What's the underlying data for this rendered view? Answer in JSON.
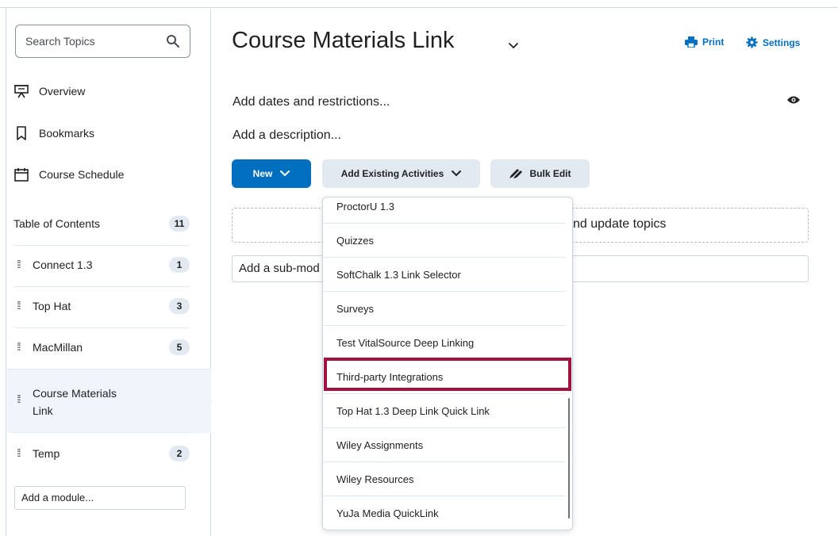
{
  "sidebar": {
    "search_placeholder": "Search Topics",
    "nav": [
      {
        "label": "Overview",
        "icon": "presentation-board-icon"
      },
      {
        "label": "Bookmarks",
        "icon": "bookmark-icon"
      },
      {
        "label": "Course Schedule",
        "icon": "calendar-icon"
      }
    ],
    "toc_label": "Table of Contents",
    "toc_count": "11",
    "modules": [
      {
        "label": "Connect 1.3",
        "count": "1"
      },
      {
        "label": "Top Hat",
        "count": "3"
      },
      {
        "label": "MacMillan",
        "count": "5"
      },
      {
        "label_line1": "Course Materials",
        "label_line2": "Link",
        "active": true
      },
      {
        "label": "Temp",
        "count": "2"
      }
    ],
    "add_module": "Add a module..."
  },
  "main": {
    "title": "Course Materials Link",
    "print_label": "Print",
    "settings_label": "Settings",
    "add_dates": "Add dates and restrictions...",
    "add_description": "Add a description...",
    "new_button": "New",
    "add_existing_button": "Add Existing Activities",
    "bulk_edit_button": "Bulk Edit",
    "dropzone_text_visible": "nd update topics",
    "submodule_text_visible": "Add a sub-mod"
  },
  "dropdown": {
    "items": [
      "ProctorU 1.3",
      "Quizzes",
      "SoftChalk 1.3 Link Selector",
      "Surveys",
      "Test VitalSource Deep Linking",
      "Third-party Integrations",
      "Top Hat 1.3 Deep Link Quick Link",
      "Wiley Assignments",
      "Wiley Resources",
      "YuJa Media QuickLink"
    ],
    "highlighted": "Third-party Integrations"
  },
  "colors": {
    "primary": "#006fbf",
    "highlight": "#a3123f",
    "badge": "#e3e9f1"
  }
}
